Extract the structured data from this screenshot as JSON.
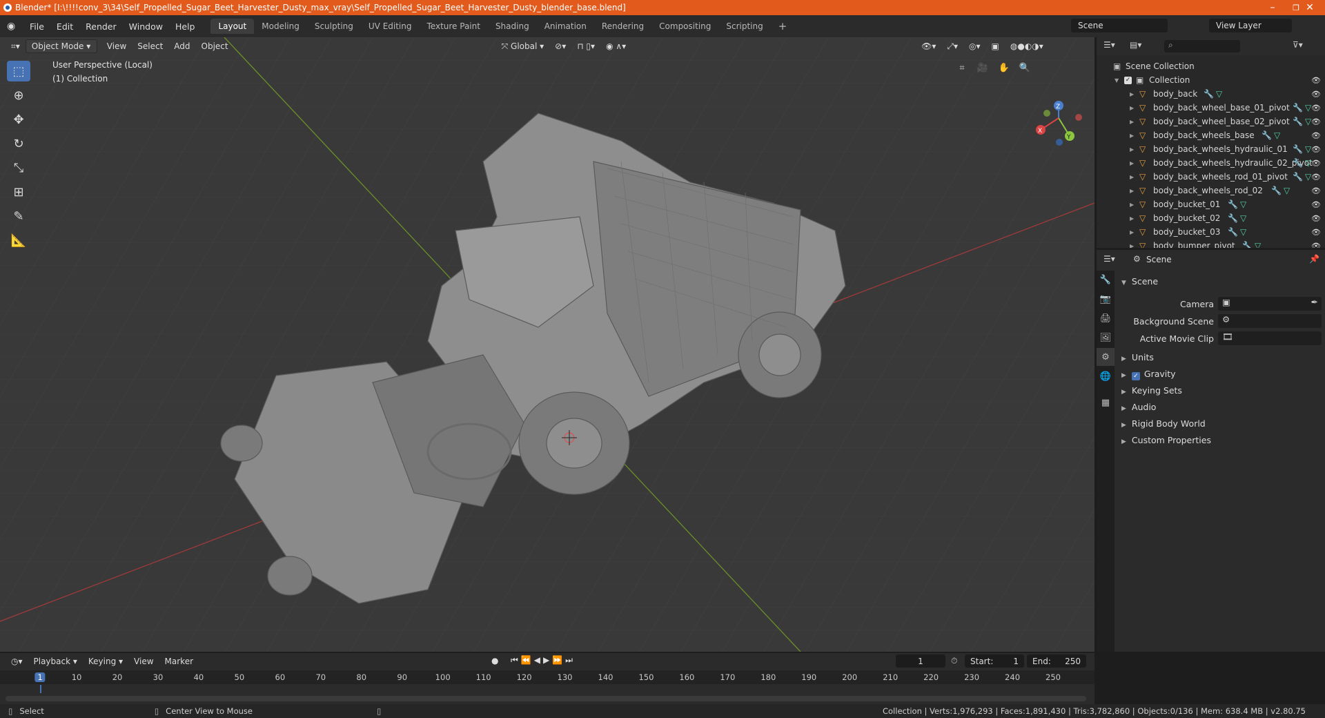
{
  "window": {
    "title": "Blender* [I:\\!!!!conv_3\\34\\Self_Propelled_Sugar_Beet_Harvester_Dusty_max_vray\\Self_Propelled_Sugar_Beet_Harvester_Dusty_blender_base.blend]",
    "minimize": "–",
    "maximize": "❐",
    "close": "✕"
  },
  "menubar": {
    "items": [
      "File",
      "Edit",
      "Render",
      "Window",
      "Help"
    ],
    "workspaces": [
      "Layout",
      "Modeling",
      "Sculpting",
      "UV Editing",
      "Texture Paint",
      "Shading",
      "Animation",
      "Rendering",
      "Compositing",
      "Scripting"
    ],
    "active_workspace": "Layout",
    "add_tab": "+",
    "scene": "Scene",
    "view_layer": "View Layer"
  },
  "viewport": {
    "mode": "Object Mode",
    "menus": [
      "View",
      "Select",
      "Add",
      "Object"
    ],
    "transform_orientation": "Global",
    "info_line1": "User Perspective (Local)",
    "info_line2": "(1) Collection",
    "gizmo": {
      "x": "X",
      "y": "Y",
      "z": "Z"
    }
  },
  "outliner": {
    "root": "Scene Collection",
    "collection": "Collection",
    "items": [
      "body_back",
      "body_back_wheel_base_01_pivot",
      "body_back_wheel_base_02_pivot",
      "body_back_wheels_base",
      "body_back_wheels_hydraulic_01",
      "body_back_wheels_hydraulic_02_pivot",
      "body_back_wheels_rod_01_pivot",
      "body_back_wheels_rod_02",
      "body_bucket_01",
      "body_bucket_02",
      "body_bucket_03",
      "body_bumper_pivot"
    ]
  },
  "properties": {
    "context": "Scene",
    "panel": "Scene",
    "fields": [
      {
        "label": "Camera"
      },
      {
        "label": "Background Scene"
      },
      {
        "label": "Active Movie Clip"
      }
    ],
    "sections": [
      "Units",
      "Gravity",
      "Keying Sets",
      "Audio",
      "Rigid Body World",
      "Custom Properties"
    ],
    "gravity_checked": true
  },
  "timeline": {
    "menus": [
      "Playback",
      "Keying",
      "View",
      "Marker"
    ],
    "current_frame": "1",
    "start_label": "Start:",
    "start": "1",
    "end_label": "End:",
    "end": "250",
    "ticks": [
      "1",
      "10",
      "20",
      "30",
      "40",
      "50",
      "60",
      "70",
      "80",
      "90",
      "100",
      "110",
      "120",
      "130",
      "140",
      "150",
      "160",
      "170",
      "180",
      "190",
      "200",
      "210",
      "220",
      "230",
      "240",
      "250"
    ]
  },
  "statusbar": {
    "left": "Select",
    "middle": "Center View to Mouse",
    "right": "Collection | Verts:1,976,293 | Faces:1,891,430 | Tris:3,782,860 | Objects:0/136 | Mem: 638.4 MB | v2.80.75"
  },
  "colors": {
    "titlebar": "#e25a1c",
    "accent": "#4772b3",
    "viewport_bg": "#393939",
    "x_axis": "#a13a3a",
    "y_axis": "#6a8f2a"
  }
}
